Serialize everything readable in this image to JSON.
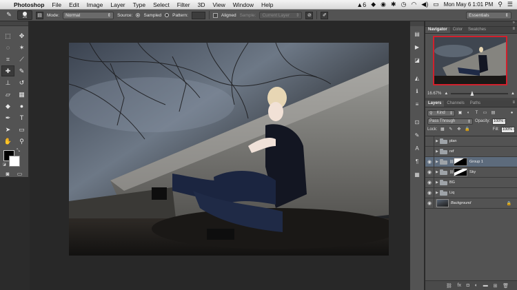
{
  "menubar": {
    "app_name": "Photoshop",
    "items": [
      "File",
      "Edit",
      "Image",
      "Layer",
      "Type",
      "Select",
      "Filter",
      "3D",
      "View",
      "Window",
      "Help"
    ],
    "status": {
      "adobe_badge_count": "6",
      "clock": "Mon May 6  1:01 PM"
    }
  },
  "options_bar": {
    "brush_size": "26",
    "mode_label": "Mode:",
    "mode_value": "Normal",
    "source_label": "Source:",
    "sampled_label": "Sampled",
    "pattern_label": "Pattern:",
    "aligned_label": "Aligned",
    "sample_label": "Sample:",
    "sample_value": "Current Layer",
    "workspace_value": "Essentials"
  },
  "navigator": {
    "tabs": [
      "Navigator",
      "Color",
      "Swatches"
    ],
    "zoom": "16.67%"
  },
  "layers_panel": {
    "tabs": [
      "Layers",
      "Channels",
      "Paths"
    ],
    "kind_label": "Kind",
    "blend_mode": "Pass Through",
    "opacity_label": "Opacity:",
    "opacity_value": "100%",
    "lock_label": "Lock:",
    "fill_label": "Fill:",
    "fill_value": "100%",
    "layers": [
      {
        "name": "plan",
        "type": "group",
        "visible": false
      },
      {
        "name": "ref",
        "type": "group",
        "visible": false
      },
      {
        "name": "Group 1",
        "type": "group",
        "visible": true,
        "has_mask": true,
        "selected": true
      },
      {
        "name": "Sky",
        "type": "group",
        "visible": true,
        "has_mask": true
      },
      {
        "name": "BG",
        "type": "group",
        "visible": true
      },
      {
        "name": "Liq",
        "type": "group",
        "visible": true
      },
      {
        "name": "Background",
        "type": "image",
        "visible": true,
        "locked": true
      }
    ]
  }
}
